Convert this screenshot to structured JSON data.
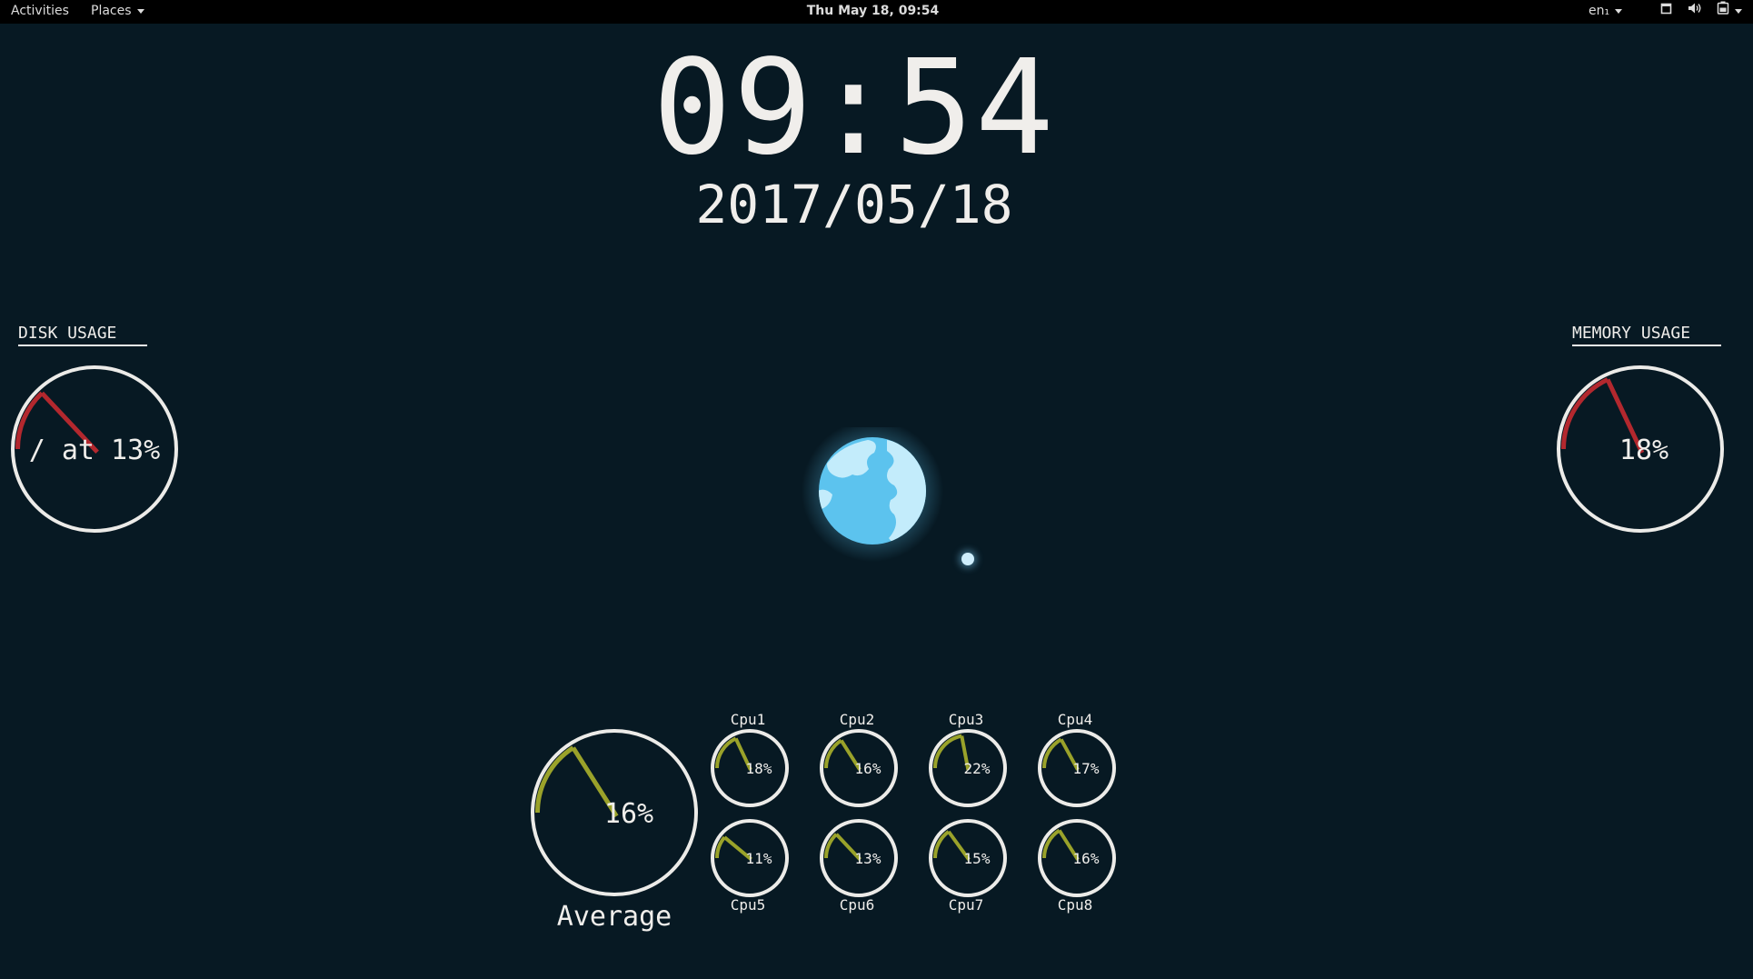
{
  "topbar": {
    "activities": "Activities",
    "places": "Places",
    "datetime": "Thu May 18, 09:54",
    "language": "en₁",
    "icons": [
      "window-icon",
      "volume-icon",
      "battery-icon"
    ]
  },
  "clock": {
    "time": "09:54",
    "date": "2017/05/18"
  },
  "disk": {
    "title": "DISK USAGE",
    "label": "/ at 13%",
    "value_percent": 13
  },
  "memory": {
    "title": "MEMORY USAGE",
    "label": "18%",
    "value_percent": 18
  },
  "cpu": {
    "average": {
      "name": "Average",
      "label": "16%",
      "value_percent": 16
    },
    "cores": [
      {
        "name": "Cpu1",
        "label": "18%",
        "value_percent": 18
      },
      {
        "name": "Cpu2",
        "label": "16%",
        "value_percent": 16
      },
      {
        "name": "Cpu3",
        "label": "22%",
        "value_percent": 22
      },
      {
        "name": "Cpu4",
        "label": "17%",
        "value_percent": 17
      },
      {
        "name": "Cpu5",
        "label": "11%",
        "value_percent": 11
      },
      {
        "name": "Cpu6",
        "label": "13%",
        "value_percent": 13
      },
      {
        "name": "Cpu7",
        "label": "15%",
        "value_percent": 15
      },
      {
        "name": "Cpu8",
        "label": "16%",
        "value_percent": 16
      }
    ]
  },
  "colors": {
    "background": "#071923",
    "gauge_ring": "#ecebe8",
    "disk_memory_arc": "#b3282e",
    "cpu_arc": "#9aa22a",
    "earth_ocean": "#5cc3ee",
    "earth_land": "#c3ecfb"
  }
}
